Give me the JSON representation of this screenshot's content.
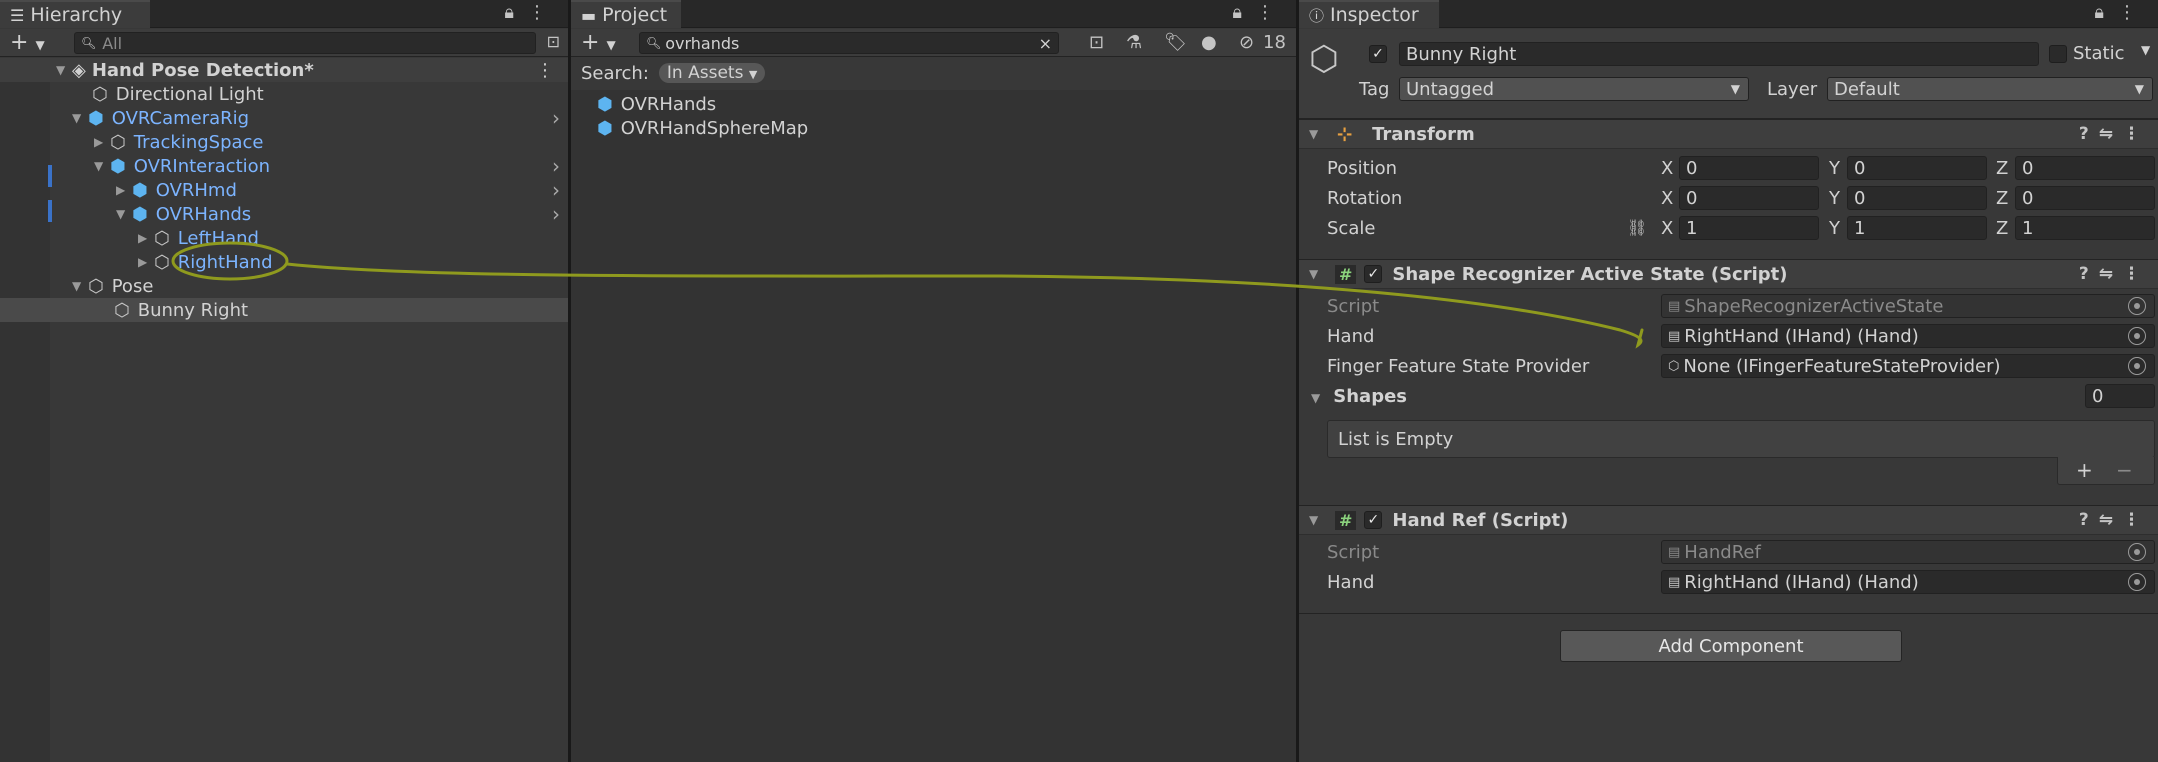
{
  "hierarchy": {
    "tab_label": "Hierarchy",
    "search_placeholder": "All",
    "scene_name": "Hand Pose Detection*",
    "items": [
      {
        "label": "Directional Light"
      },
      {
        "label": "OVRCameraRig"
      },
      {
        "label": "TrackingSpace"
      },
      {
        "label": "OVRInteraction"
      },
      {
        "label": "OVRHmd"
      },
      {
        "label": "OVRHands"
      },
      {
        "label": "LeftHand"
      },
      {
        "label": "RightHand"
      },
      {
        "label": "Pose"
      },
      {
        "label": "Bunny Right"
      }
    ]
  },
  "project": {
    "tab_label": "Project",
    "search_value": "ovrhands",
    "search_label": "Search:",
    "search_scope": "In Assets",
    "hidden_count": "18",
    "results": [
      {
        "label": "OVRHands"
      },
      {
        "label": "OVRHandSphereMap"
      }
    ]
  },
  "inspector": {
    "tab_label": "Inspector",
    "object_name": "Bunny Right",
    "static_label": "Static",
    "tag_label": "Tag",
    "tag_value": "Untagged",
    "layer_label": "Layer",
    "layer_value": "Default",
    "transform": {
      "title": "Transform",
      "position_label": "Position",
      "rotation_label": "Rotation",
      "scale_label": "Scale",
      "axis_x": "X",
      "axis_y": "Y",
      "axis_z": "Z",
      "position": [
        "0",
        "0",
        "0"
      ],
      "rotation": [
        "0",
        "0",
        "0"
      ],
      "scale": [
        "1",
        "1",
        "1"
      ]
    },
    "shape_recognizer": {
      "title": "Shape Recognizer Active State (Script)",
      "script_label": "Script",
      "script_value": "ShapeRecognizerActiveState",
      "hand_label": "Hand",
      "hand_value": "RightHand (IHand) (Hand)",
      "finger_label": "Finger Feature State Provider",
      "finger_value": "None (IFingerFeatureStateProvider)",
      "shapes_label": "Shapes",
      "shapes_count": "0",
      "list_empty": "List is Empty",
      "add": "+",
      "remove": "−"
    },
    "hand_ref": {
      "title": "Hand Ref (Script)",
      "script_label": "Script",
      "script_value": "HandRef",
      "hand_label": "Hand",
      "hand_value": "RightHand (IHand) (Hand)"
    },
    "add_component": "Add Component"
  },
  "colors": {
    "annotation": "#8f9a1e",
    "selection_bar": "#3a72c8",
    "prefab_blue": "#7cb4ff"
  }
}
